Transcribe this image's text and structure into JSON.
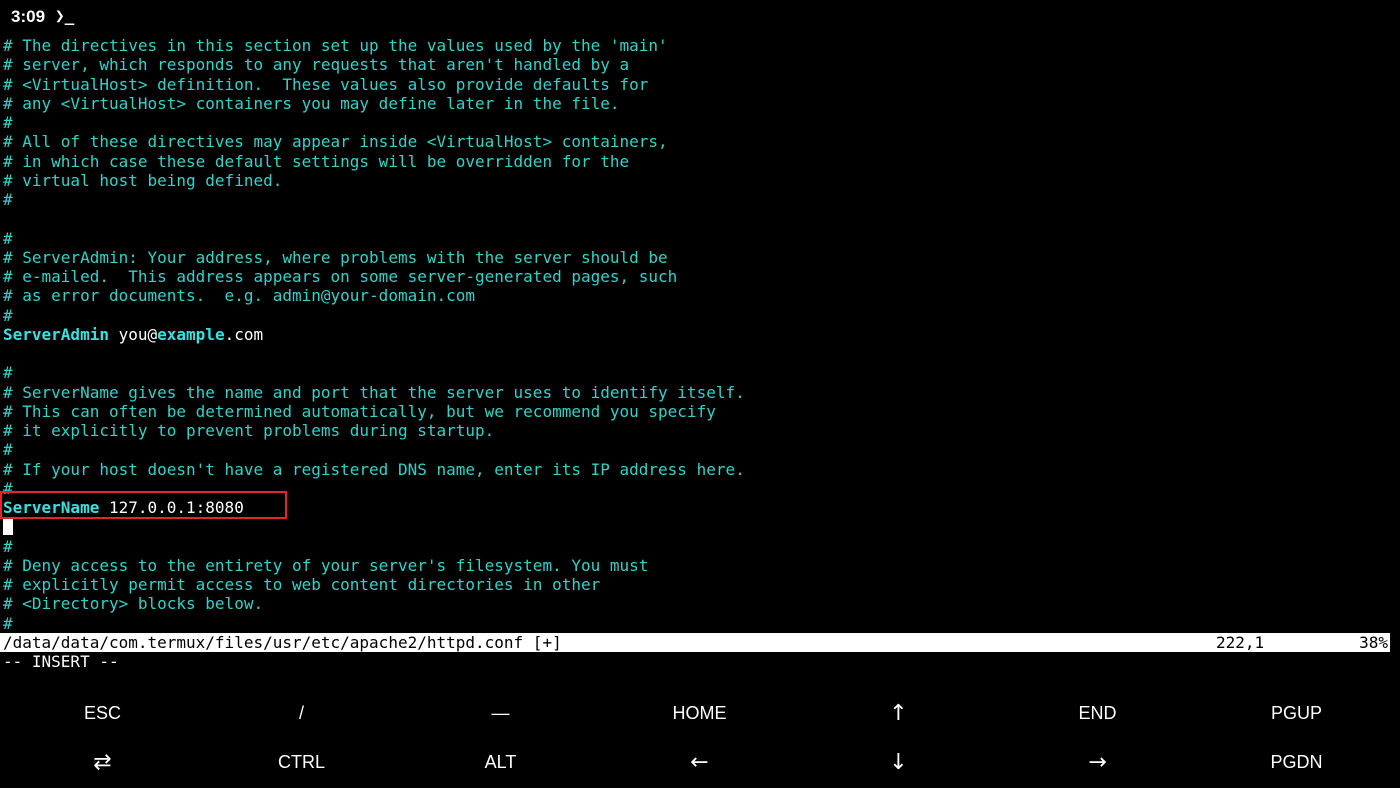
{
  "statusbar": {
    "time": "3:09",
    "terminal_indicator": "❯_"
  },
  "editor": {
    "lines": [
      {
        "type": "comment",
        "text": "# The directives in this section set up the values used by the 'main'"
      },
      {
        "type": "comment",
        "text": "# server, which responds to any requests that aren't handled by a"
      },
      {
        "type": "comment",
        "text": "# <VirtualHost> definition.  These values also provide defaults for"
      },
      {
        "type": "comment",
        "text": "# any <VirtualHost> containers you may define later in the file."
      },
      {
        "type": "comment",
        "text": "#"
      },
      {
        "type": "comment",
        "text": "# All of these directives may appear inside <VirtualHost> containers,"
      },
      {
        "type": "comment",
        "text": "# in which case these default settings will be overridden for the"
      },
      {
        "type": "comment",
        "text": "# virtual host being defined."
      },
      {
        "type": "comment",
        "text": "#"
      },
      {
        "type": "blank",
        "text": ""
      },
      {
        "type": "comment",
        "text": "#"
      },
      {
        "type": "comment",
        "text": "# ServerAdmin: Your address, where problems with the server should be"
      },
      {
        "type": "comment",
        "text": "# e-mailed.  This address appears on some server-generated pages, such"
      },
      {
        "type": "comment",
        "text": "# as error documents.  e.g. admin@your-domain.com"
      },
      {
        "type": "comment",
        "text": "#"
      },
      {
        "type": "serveradmin",
        "keyword": "ServerAdmin",
        "pre": " you@",
        "domain": "example",
        "post": ".com"
      },
      {
        "type": "blank",
        "text": ""
      },
      {
        "type": "comment",
        "text": "#"
      },
      {
        "type": "comment",
        "text": "# ServerName gives the name and port that the server uses to identify itself."
      },
      {
        "type": "comment",
        "text": "# This can often be determined automatically, but we recommend you specify"
      },
      {
        "type": "comment",
        "text": "# it explicitly to prevent problems during startup."
      },
      {
        "type": "comment",
        "text": "#"
      },
      {
        "type": "comment",
        "text": "# If your host doesn't have a registered DNS name, enter its IP address here."
      },
      {
        "type": "comment",
        "text": "#"
      },
      {
        "type": "directive",
        "keyword": "ServerName",
        "value": " 127.0.0.1:8080"
      },
      {
        "type": "cursor",
        "text": ""
      },
      {
        "type": "comment",
        "text": "#"
      },
      {
        "type": "comment",
        "text": "# Deny access to the entirety of your server's filesystem. You must"
      },
      {
        "type": "comment",
        "text": "# explicitly permit access to web content directories in other"
      },
      {
        "type": "comment",
        "text": "# <Directory> blocks below."
      },
      {
        "type": "comment",
        "text": "#"
      }
    ]
  },
  "vim": {
    "file_path": "/data/data/com.termux/files/usr/etc/apache2/httpd.conf [+]",
    "position": "222,1",
    "percent": "38%",
    "mode": "-- INSERT --"
  },
  "extra_keys": {
    "row1": [
      {
        "label": "ESC",
        "name": "esc-key"
      },
      {
        "label": "/",
        "name": "slash-key"
      },
      {
        "label": "—",
        "name": "dash-key"
      },
      {
        "label": "HOME",
        "name": "home-key"
      },
      {
        "label": "↑",
        "name": "arrow-up-key"
      },
      {
        "label": "END",
        "name": "end-key"
      },
      {
        "label": "PGUP",
        "name": "pgup-key"
      }
    ],
    "row2": [
      {
        "label": "⇄",
        "name": "tab-key"
      },
      {
        "label": "CTRL",
        "name": "ctrl-key"
      },
      {
        "label": "ALT",
        "name": "alt-key"
      },
      {
        "label": "←",
        "name": "arrow-left-key"
      },
      {
        "label": "↓",
        "name": "arrow-down-key"
      },
      {
        "label": "→",
        "name": "arrow-right-key"
      },
      {
        "label": "PGDN",
        "name": "pgdn-key"
      }
    ]
  },
  "colors": {
    "comment": "#31d3c9",
    "keyword": "#34e2e2",
    "highlight_box": "#e8232b",
    "background": "#000000"
  }
}
